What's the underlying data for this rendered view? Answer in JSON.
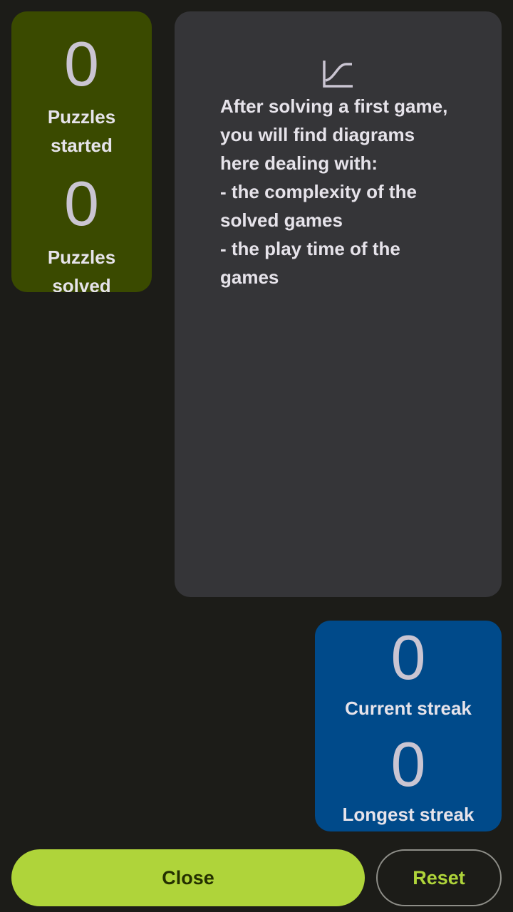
{
  "stats": {
    "started_value": "0",
    "started_label": "Puzzles\nstarted",
    "solved_value": "0",
    "solved_label": "Puzzles\nsolved"
  },
  "diagram": {
    "icon": "chart-curve-icon",
    "message": "After solving a first game,\nyou will find diagrams\nhere dealing with:\n- the complexity of the\nsolved games\n- the play time of the\ngames"
  },
  "streak": {
    "current_value": "0",
    "current_label": "Current streak",
    "longest_value": "0",
    "longest_label": "Longest streak"
  },
  "buttons": {
    "close": "Close",
    "reset": "Reset"
  },
  "colors": {
    "accent": "#afd43a",
    "stats_card": "#3a4a00",
    "streak_card": "#004a8a",
    "diagram_card": "#353538"
  }
}
